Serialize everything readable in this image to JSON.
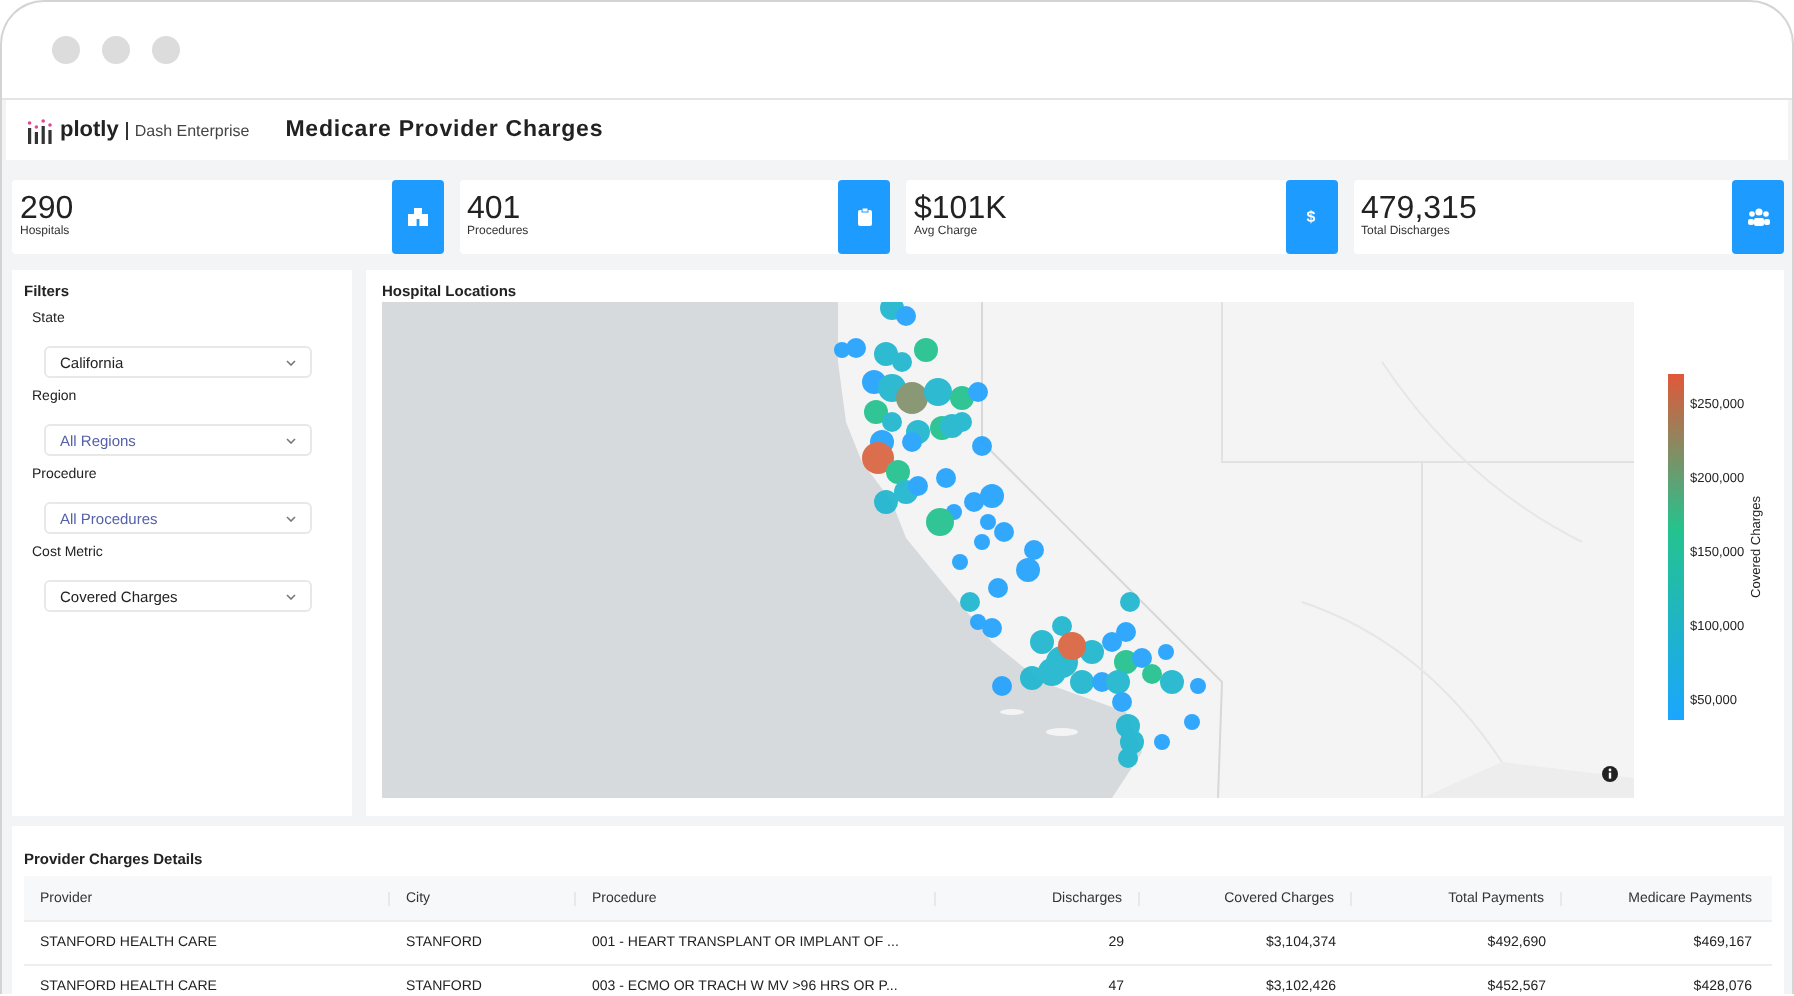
{
  "header": {
    "logo_text": "plotly",
    "logo_subtitle": "Dash Enterprise",
    "title": "Medicare Provider Charges"
  },
  "kpis": [
    {
      "value": "290",
      "label": "Hospitals",
      "kind": "hospital"
    },
    {
      "value": "401",
      "label": "Procedures",
      "kind": "clipboard"
    },
    {
      "value": "$101K",
      "label": "Avg Charge",
      "kind": "glyph",
      "glyph": "$"
    },
    {
      "value": "479,315",
      "label": "Total Discharges",
      "kind": "users"
    }
  ],
  "filters": {
    "title": "Filters",
    "fields": [
      {
        "label": "State",
        "value": "California",
        "is_default": false
      },
      {
        "label": "Region",
        "value": "All Regions",
        "is_default": true
      },
      {
        "label": "Procedure",
        "value": "All Procedures",
        "is_default": true
      },
      {
        "label": "Cost Metric",
        "value": "Covered Charges",
        "is_default": false
      }
    ]
  },
  "map": {
    "title": "Hospital Locations",
    "colorbar": {
      "title": "Covered Charges",
      "ticks": [
        "$250,000",
        "$200,000",
        "$150,000",
        "$100,000",
        "$50,000"
      ]
    }
  },
  "table": {
    "title": "Provider Charges Details",
    "columns": [
      {
        "label": "Provider",
        "kind": "text"
      },
      {
        "label": "City",
        "kind": "text"
      },
      {
        "label": "Procedure",
        "kind": "text"
      },
      {
        "label": "Discharges",
        "kind": "number"
      },
      {
        "label": "Covered Charges",
        "kind": "number"
      },
      {
        "label": "Total Payments",
        "kind": "number"
      },
      {
        "label": "Medicare Payments",
        "kind": "number"
      }
    ],
    "rows": [
      [
        "STANFORD HEALTH CARE",
        "STANFORD",
        "001 - HEART TRANSPLANT OR IMPLANT OF ...",
        "29",
        "$3,104,374",
        "$492,690",
        "$469,167"
      ],
      [
        "STANFORD HEALTH CARE",
        "STANFORD",
        "003 - ECMO OR TRACH W MV >96 HRS OR P...",
        "47",
        "$3,102,426",
        "$452,567",
        "$428,076"
      ]
    ]
  }
}
